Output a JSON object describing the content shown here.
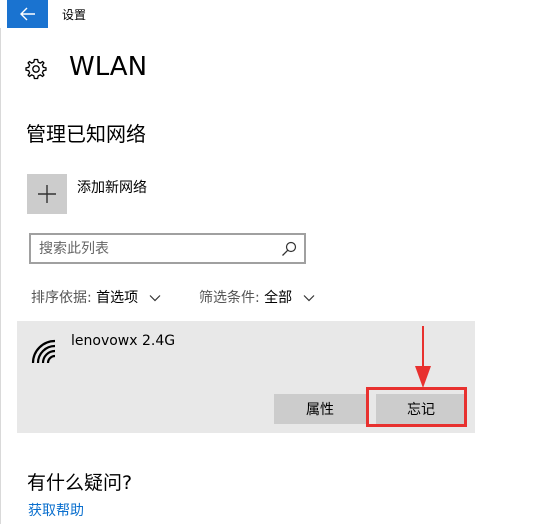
{
  "window": {
    "title": "设置",
    "accent_color": "#1a73d0"
  },
  "header": {
    "title": "WLAN",
    "icon": "gear-icon"
  },
  "manage": {
    "section_title": "管理已知网络",
    "add_network_label": "添加新网络"
  },
  "search": {
    "placeholder": "搜索此列表",
    "value": ""
  },
  "filters": {
    "sort_label": "排序依据:",
    "sort_value": "首选项",
    "filter_label": "筛选条件:",
    "filter_value": "全部"
  },
  "networks": [
    {
      "name": "lenovowx 2.4G",
      "icon": "wifi-icon",
      "selected": true,
      "actions": {
        "properties_label": "属性",
        "forget_label": "忘记"
      }
    }
  ],
  "annotation": {
    "color": "#e8312f",
    "target": "forget-button"
  },
  "help": {
    "title": "有什么疑问?",
    "link_label": "获取帮助",
    "link_color": "#0a6fce"
  }
}
